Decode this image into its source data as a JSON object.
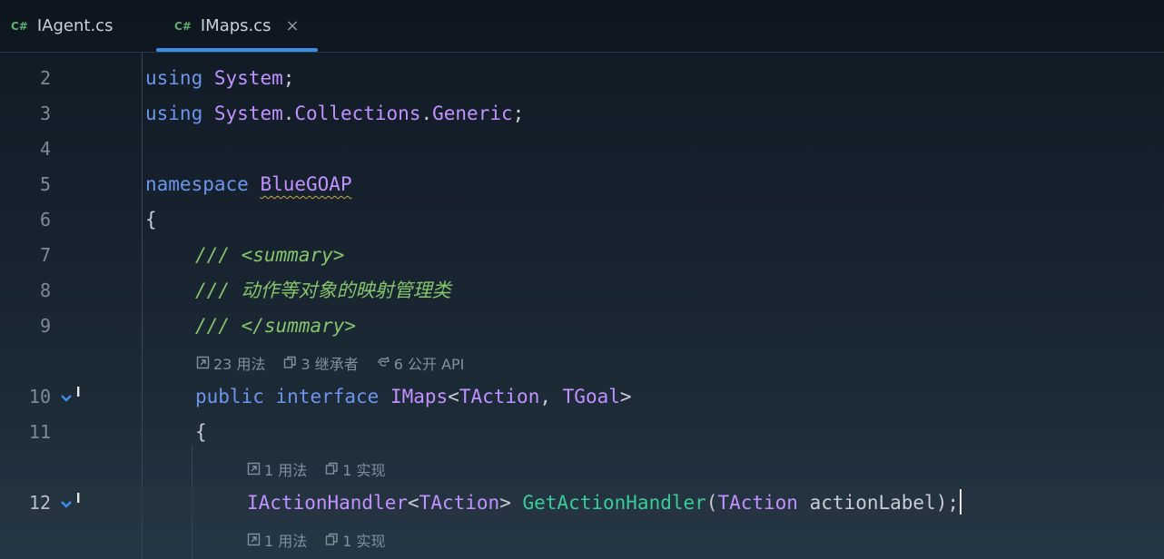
{
  "tabs": [
    {
      "lang": "C#",
      "label": "IAgent.cs",
      "active": false
    },
    {
      "lang": "C#",
      "label": "IMaps.cs",
      "active": true,
      "close": "×"
    }
  ],
  "lines": {
    "l2": {
      "num": "2",
      "kw": "using",
      "rest_ns": "System",
      "end": ";"
    },
    "l3": {
      "num": "3",
      "kw": "using",
      "ns1": "System",
      "dot1": ".",
      "ns2": "Collections",
      "dot2": ".",
      "ns3": "Generic",
      "end": ";"
    },
    "l4": {
      "num": "4"
    },
    "l5": {
      "num": "5",
      "kw": "namespace",
      "name": "BlueGOAP"
    },
    "l6": {
      "num": "6",
      "brace": "{"
    },
    "l7": {
      "num": "7",
      "slashes": "///",
      "open": "<",
      "tag": "summary",
      "close": ">"
    },
    "l8": {
      "num": "8",
      "slashes": "///",
      "text": "动作等对象的映射管理类"
    },
    "l9": {
      "num": "9",
      "slashes": "///",
      "open": "</",
      "tag": "summary",
      "close": ">"
    },
    "l10": {
      "num": "10",
      "kw1": "public",
      "kw2": "interface",
      "name": "IMaps",
      "lt": "<",
      "t1": "TAction",
      "comma": ", ",
      "t2": "TGoal",
      "gt": ">"
    },
    "l11": {
      "num": "11",
      "brace": "{"
    },
    "l12": {
      "num": "12",
      "ret": "IActionHandler",
      "lt": "<",
      "t1": "TAction",
      "gt": ">",
      "method": "GetActionHandler",
      "lp": "(",
      "ptype": "TAction",
      "pname": "actionLabel",
      "rp": ");"
    }
  },
  "hints": {
    "interface": {
      "usages": "23 用法",
      "inheritors": "3 继承者",
      "api": "6 公开 API"
    },
    "method1": {
      "usages": "1 用法",
      "impls": "1 实现"
    },
    "method2": {
      "usages": "1 用法",
      "impls": "1 实现"
    }
  },
  "colors": {
    "keyword": "#6c95eb",
    "type": "#c191ff",
    "method": "#39cc9b",
    "comment": "#85c46c",
    "accent": "#3b8ee8"
  }
}
